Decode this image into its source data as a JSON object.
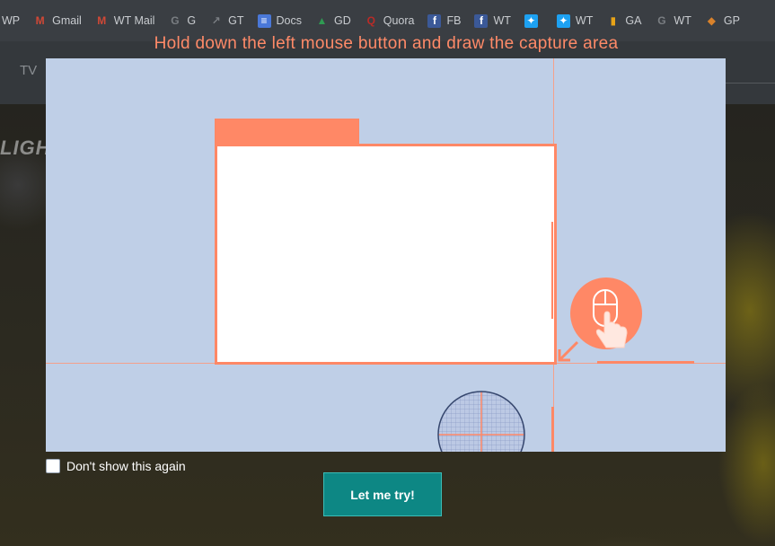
{
  "browser": {
    "bookmarks": [
      {
        "label": "WP",
        "icon": "none",
        "color": "#3a3e43"
      },
      {
        "label": "Gmail",
        "icon": "gmail-icon",
        "glyph": "M",
        "color": "#d14836"
      },
      {
        "label": "WT Mail",
        "icon": "gmail-icon",
        "glyph": "M",
        "color": "#d14836"
      },
      {
        "label": "G",
        "icon": "google-icon",
        "glyph": "G",
        "color": "#7a7e83"
      },
      {
        "label": "GT",
        "icon": "trends-icon",
        "glyph": "↗",
        "color": "#7a7e83"
      },
      {
        "label": "Docs",
        "icon": "docs-icon",
        "glyph": "≡",
        "color": "#4a78d8"
      },
      {
        "label": "GD",
        "icon": "drive-icon",
        "glyph": "▲",
        "color": "#2f9a52"
      },
      {
        "label": "Quora",
        "icon": "quora-icon",
        "glyph": "Q",
        "color": "#b92b27"
      },
      {
        "label": "FB",
        "icon": "facebook-icon",
        "glyph": "f",
        "color": "#3b5998"
      },
      {
        "label": "WT",
        "icon": "facebook-icon",
        "glyph": "f",
        "color": "#3b5998"
      },
      {
        "label": "",
        "icon": "twitter-icon",
        "glyph": "✦",
        "color": "#1da1f2"
      },
      {
        "label": "WT",
        "icon": "twitter-icon",
        "glyph": "✦",
        "color": "#1da1f2"
      },
      {
        "label": "GA",
        "icon": "analytics-icon",
        "glyph": "▮",
        "color": "#e8a317"
      },
      {
        "label": "WT",
        "icon": "google-icon",
        "glyph": "G",
        "color": "#7a7e83"
      },
      {
        "label": "GP",
        "icon": "pagespeed-icon",
        "glyph": "◆",
        "color": "#d9822b"
      }
    ]
  },
  "background_page": {
    "nav_text": "TV",
    "banner_text": "LIGH"
  },
  "overlay": {
    "headline": "Hold down the left mouse button and draw the capture area",
    "dont_show_label": "Don't show this again",
    "dont_show_checked": false,
    "try_button_label": "Let me try!"
  },
  "colors": {
    "accent": "#ff8866",
    "panel": "#bfcfe7",
    "button": "#0d8784"
  }
}
